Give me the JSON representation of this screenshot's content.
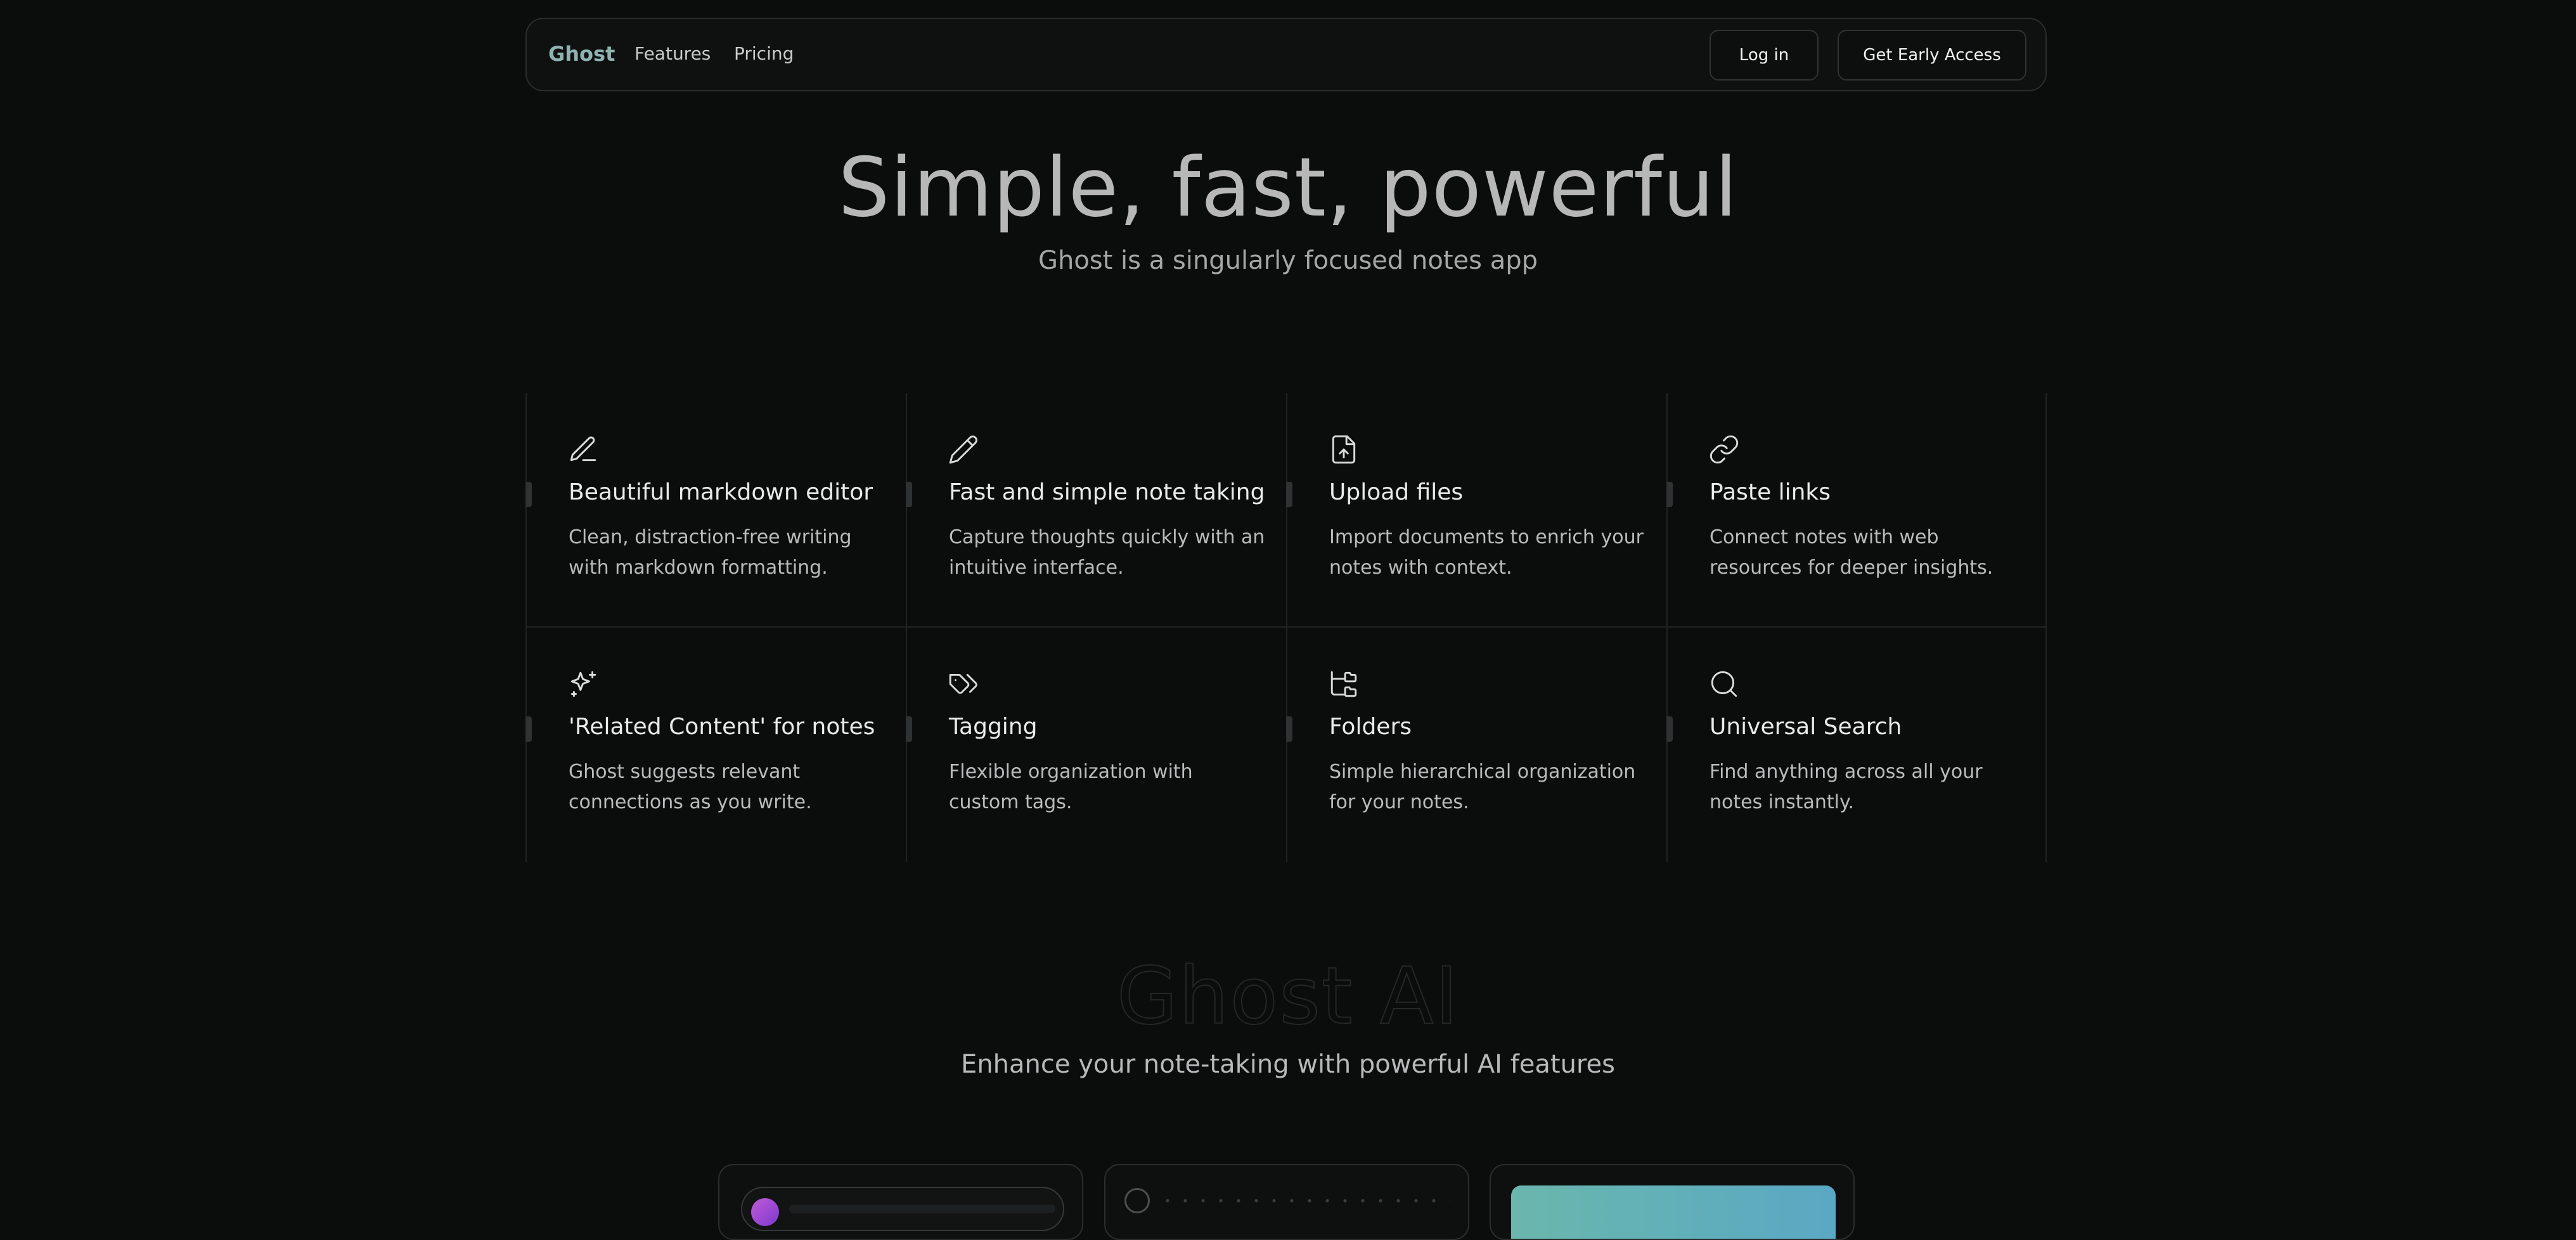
{
  "nav": {
    "brand": "Ghost",
    "links": [
      "Features",
      "Pricing"
    ],
    "login_label": "Log in",
    "cta_label": "Get Early Access"
  },
  "hero": {
    "title": "Simple, fast, powerful",
    "subtitle": "Ghost is a singularly focused notes app"
  },
  "features": [
    {
      "icon": "pen-line-icon",
      "title": "Beautiful markdown editor",
      "desc": "Clean, distraction-free writing with markdown formatting."
    },
    {
      "icon": "pencil-icon",
      "title": "Fast and simple note taking",
      "desc": "Capture thoughts quickly with an intuitive interface."
    },
    {
      "icon": "file-upload-icon",
      "title": "Upload files",
      "desc": "Import documents to enrich your notes with context."
    },
    {
      "icon": "link-icon",
      "title": "Paste links",
      "desc": "Connect notes with web resources for deeper insights."
    },
    {
      "icon": "sparkles-icon",
      "title": "'Related Content' for notes",
      "desc": "Ghost suggests relevant connections as you write."
    },
    {
      "icon": "tags-icon",
      "title": "Tagging",
      "desc": "Flexible organization with custom tags."
    },
    {
      "icon": "folder-tree-icon",
      "title": "Folders",
      "desc": "Simple hierarchical organization for your notes."
    },
    {
      "icon": "search-icon",
      "title": "Universal Search",
      "desc": "Find anything across all your notes instantly."
    }
  ],
  "ai": {
    "title": "Ghost AI",
    "subtitle": "Enhance your note-taking with powerful AI features"
  },
  "colors": {
    "background": "#0b0c0c",
    "brand": "#8fb3b0",
    "accent_gradient_start": "#6ab7ad",
    "accent_gradient_end": "#5aa8c4"
  }
}
